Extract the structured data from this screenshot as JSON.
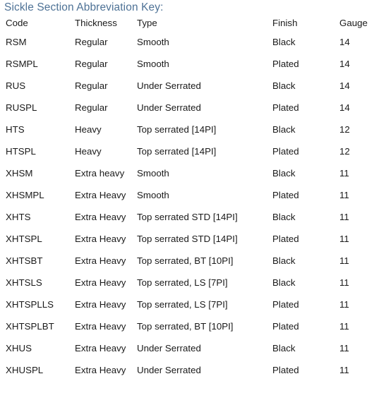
{
  "document": {
    "title": "Sickle Section Abbreviation Key:",
    "accent_color": "#4e7296",
    "text_color": "#1a1a1a",
    "background_color": "#ffffff"
  },
  "table": {
    "columns": [
      {
        "key": "code",
        "label": "Code"
      },
      {
        "key": "thickness",
        "label": "Thickness"
      },
      {
        "key": "type",
        "label": "Type"
      },
      {
        "key": "finish",
        "label": "Finish"
      },
      {
        "key": "gauge",
        "label": "Gauge"
      }
    ],
    "rows": [
      {
        "code": "RSM",
        "thickness": "Regular",
        "type": "Smooth",
        "finish": "Black",
        "gauge": "14"
      },
      {
        "code": "RSMPL",
        "thickness": "Regular",
        "type": "Smooth",
        "finish": "Plated",
        "gauge": "14"
      },
      {
        "code": "RUS",
        "thickness": "Regular",
        "type": "Under Serrated",
        "finish": "Black",
        "gauge": "14"
      },
      {
        "code": "RUSPL",
        "thickness": "Regular",
        "type": "Under Serrated",
        "finish": "Plated",
        "gauge": "14"
      },
      {
        "code": "HTS",
        "thickness": "Heavy",
        "type": "Top serrated [14PI]",
        "finish": "Black",
        "gauge": "12"
      },
      {
        "code": "HTSPL",
        "thickness": "Heavy",
        "type": "Top serrated [14PI]",
        "finish": "Plated",
        "gauge": "12"
      },
      {
        "code": "XHSM",
        "thickness": "Extra heavy",
        "type": "Smooth",
        "finish": "Black",
        "gauge": "11"
      },
      {
        "code": "XHSMPL",
        "thickness": "Extra Heavy",
        "type": "Smooth",
        "finish": "Plated",
        "gauge": "11"
      },
      {
        "code": "XHTS",
        "thickness": "Extra Heavy",
        "type": "Top serrated STD [14PI]",
        "finish": "Black",
        "gauge": "11"
      },
      {
        "code": "XHTSPL",
        "thickness": "Extra Heavy",
        "type": "Top serrated STD [14PI]",
        "finish": "Plated",
        "gauge": "11"
      },
      {
        "code": "XHTSBT",
        "thickness": "Extra Heavy",
        "type": "Top serrated, BT [10PI]",
        "finish": "Black",
        "gauge": "11"
      },
      {
        "code": "XHTSLS",
        "thickness": "Extra Heavy",
        "type": "Top serrated, LS [7PI]",
        "finish": "Black",
        "gauge": "11"
      },
      {
        "code": "XHTSPLLS",
        "thickness": "Extra Heavy",
        "type": "Top serrated, LS [7PI]",
        "finish": "Plated",
        "gauge": "11"
      },
      {
        "code": "XHTSPLBT",
        "thickness": "Extra Heavy",
        "type": "Top serrated, BT [10PI]",
        "finish": "Plated",
        "gauge": "11"
      },
      {
        "code": "XHUS",
        "thickness": "Extra Heavy",
        "type": "Under Serrated",
        "finish": "Black",
        "gauge": "11"
      },
      {
        "code": "XHUSPL",
        "thickness": "Extra Heavy",
        "type": "Under Serrated",
        "finish": "Plated",
        "gauge": "11"
      }
    ]
  }
}
